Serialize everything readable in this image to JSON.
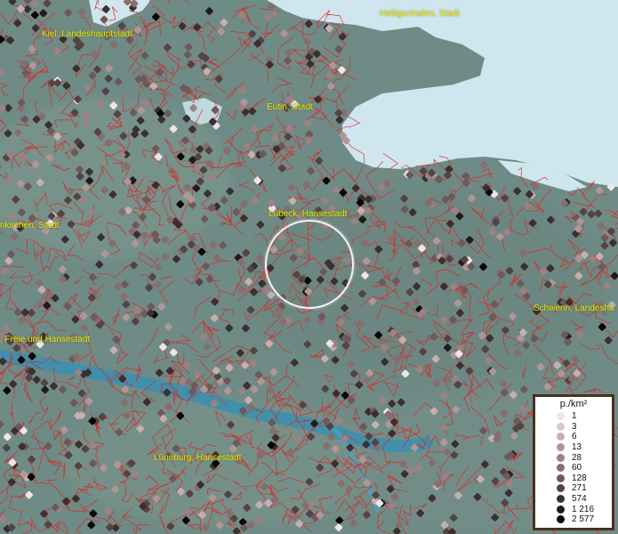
{
  "cities": [
    {
      "id": "kiel",
      "name": "Kiel, Landeshauptstadt"
    },
    {
      "id": "heiligenhafen",
      "name": "Heiligenhafen, Stadt"
    },
    {
      "id": "eutin",
      "name": "Eutin, Stadt"
    },
    {
      "id": "luebeck",
      "name": "Lübeck, Hansestadt"
    },
    {
      "id": "neumuenster",
      "name": "nkirchen, Stadt"
    },
    {
      "id": "hamburg",
      "name": ", Freie und Hansestadt"
    },
    {
      "id": "schwerin",
      "name": "Schwerin, Landesha"
    },
    {
      "id": "lueneburg",
      "name": "Lüneburg, Hansestadt"
    }
  ],
  "legend": {
    "title": "p./km²",
    "items": [
      {
        "label": "1",
        "color": "#f1e4e4"
      },
      {
        "label": "3",
        "color": "#dcc8c8"
      },
      {
        "label": "6",
        "color": "#c8aeb0"
      },
      {
        "label": "13",
        "color": "#b29697"
      },
      {
        "label": "28",
        "color": "#9e8182"
      },
      {
        "label": "60",
        "color": "#876d6e"
      },
      {
        "label": "128",
        "color": "#6e5859"
      },
      {
        "label": "271",
        "color": "#554344"
      },
      {
        "label": "574",
        "color": "#3c2f30"
      },
      {
        "label": "1 216",
        "color": "#221a1b"
      },
      {
        "label": "2 577",
        "color": "#080606"
      }
    ]
  },
  "colors": {
    "water": "#cfe6ef",
    "land": "#6f8b86",
    "borders": "#e02020",
    "labels": "#e6e600",
    "river": "#3a8fb0"
  }
}
